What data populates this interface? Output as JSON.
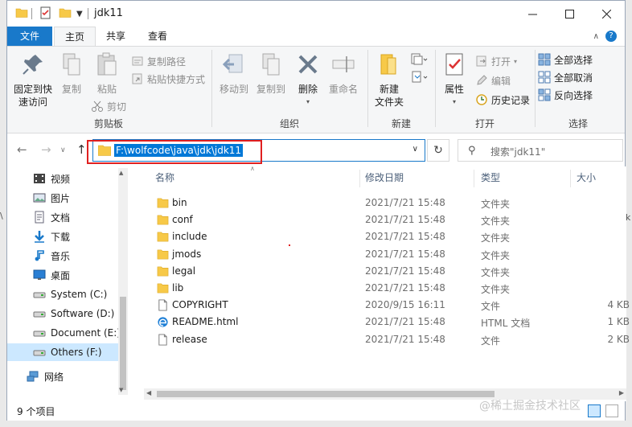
{
  "window": {
    "title": "jdk11"
  },
  "quick_access": {
    "folder_icon": "folder-icon",
    "properties_icon": "properties-icon"
  },
  "tabs": {
    "file": "文件",
    "home": "主页",
    "share": "共享",
    "view": "查看"
  },
  "ribbon": {
    "clipboard": {
      "label": "剪贴板",
      "pin": "固定到快\n速访问",
      "copy": "复制",
      "paste": "粘贴",
      "copy_path": "复制路径",
      "paste_shortcut": "粘贴快捷方式",
      "cut": "剪切"
    },
    "organize": {
      "label": "组织",
      "move_to": "移动到",
      "copy_to": "复制到",
      "delete": "删除",
      "rename": "重命名"
    },
    "new": {
      "label": "新建",
      "new_folder": "新建\n文件夹"
    },
    "open": {
      "label": "打开",
      "properties": "属性",
      "open": "打开",
      "edit": "编辑",
      "history": "历史记录"
    },
    "select": {
      "label": "选择",
      "select_all": "全部选择",
      "select_none": "全部取消",
      "invert": "反向选择"
    }
  },
  "address": {
    "path": "F:\\wolfcode\\java\\jdk\\jdk11"
  },
  "search": {
    "placeholder": "搜索\"jdk11\""
  },
  "nav_pane": {
    "items": [
      {
        "label": "视频",
        "icon": "video-icon"
      },
      {
        "label": "图片",
        "icon": "pictures-icon"
      },
      {
        "label": "文档",
        "icon": "documents-icon"
      },
      {
        "label": "下载",
        "icon": "download-icon"
      },
      {
        "label": "音乐",
        "icon": "music-icon"
      },
      {
        "label": "桌面",
        "icon": "desktop-icon"
      },
      {
        "label": "System (C:)",
        "icon": "drive-icon"
      },
      {
        "label": "Software (D:)",
        "icon": "drive-icon"
      },
      {
        "label": "Document (E:)",
        "icon": "drive-icon"
      },
      {
        "label": "Others (F:)",
        "icon": "drive-icon",
        "selected": true
      },
      {
        "label": "网络",
        "icon": "network-icon"
      }
    ]
  },
  "file_list": {
    "columns": {
      "name": "名称",
      "date": "修改日期",
      "type": "类型",
      "size": "大小"
    },
    "rows": [
      {
        "name": "bin",
        "date": "2021/7/21 15:48",
        "type": "文件夹",
        "size": "",
        "kind": "folder"
      },
      {
        "name": "conf",
        "date": "2021/7/21 15:48",
        "type": "文件夹",
        "size": "",
        "kind": "folder"
      },
      {
        "name": "include",
        "date": "2021/7/21 15:48",
        "type": "文件夹",
        "size": "",
        "kind": "folder"
      },
      {
        "name": "jmods",
        "date": "2021/7/21 15:48",
        "type": "文件夹",
        "size": "",
        "kind": "folder"
      },
      {
        "name": "legal",
        "date": "2021/7/21 15:48",
        "type": "文件夹",
        "size": "",
        "kind": "folder"
      },
      {
        "name": "lib",
        "date": "2021/7/21 15:48",
        "type": "文件夹",
        "size": "",
        "kind": "folder"
      },
      {
        "name": "COPYRIGHT",
        "date": "2020/9/15 16:11",
        "type": "文件",
        "size": "4 KB",
        "kind": "file"
      },
      {
        "name": "README.html",
        "date": "2021/7/21 15:48",
        "type": "HTML 文档",
        "size": "1 KB",
        "kind": "html"
      },
      {
        "name": "release",
        "date": "2021/7/21 15:48",
        "type": "文件",
        "size": "2 KB",
        "kind": "file"
      }
    ]
  },
  "status": {
    "item_count": "9 个项目"
  },
  "watermark": "@稀土掘金技术社区",
  "colors": {
    "accent": "#1979ca",
    "selection": "#0078d7",
    "highlight_box": "#e02020",
    "folder": "#f7c948"
  }
}
